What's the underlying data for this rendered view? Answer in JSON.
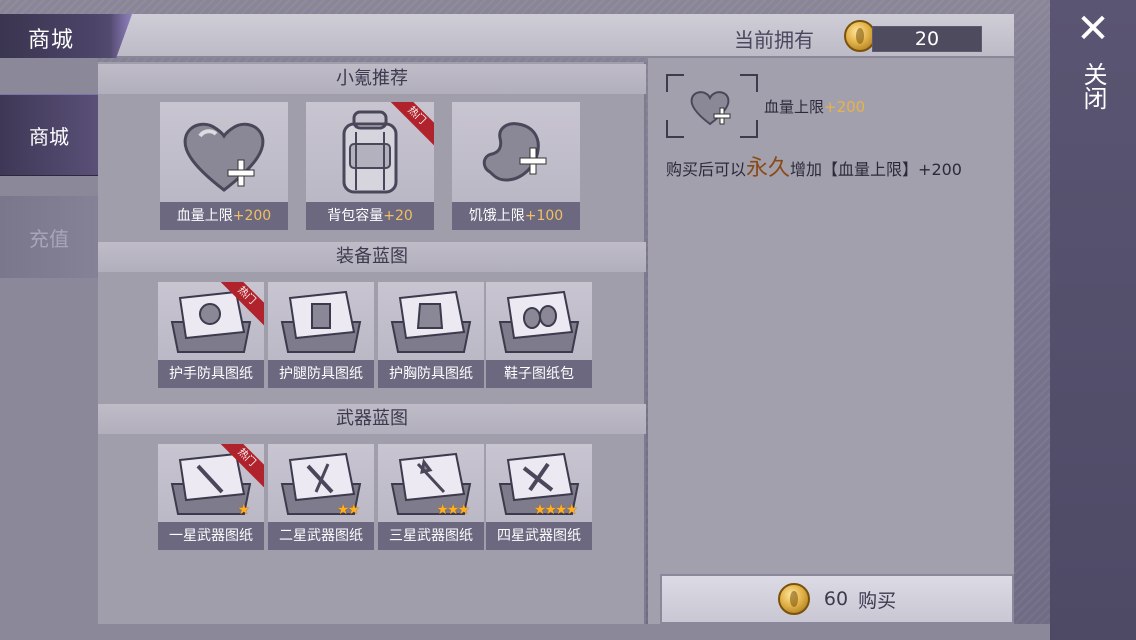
{
  "header": {
    "title": "商城",
    "owned_label": "当前拥有",
    "owned_amount": "20"
  },
  "close": {
    "icon": "close-icon",
    "label": "关闭"
  },
  "sidebar": {
    "tabs": [
      {
        "label": "商城",
        "active": true
      },
      {
        "label": "充值",
        "active": false
      }
    ]
  },
  "sections": [
    {
      "title": "小氪推荐",
      "items": [
        {
          "name": "血量上限",
          "bonus": "+200",
          "icon": "heart-plus-icon",
          "badge": "",
          "selected": true
        },
        {
          "name": "背包容量",
          "bonus": "+20",
          "icon": "backpack-icon",
          "badge": "热门",
          "selected": false
        },
        {
          "name": "饥饿上限",
          "bonus": "+100",
          "icon": "stomach-plus-icon",
          "badge": "",
          "selected": false
        }
      ]
    },
    {
      "title": "装备蓝图",
      "items": [
        {
          "name": "护手防具图纸",
          "icon": "gloves-blueprint-icon",
          "badge": "热门"
        },
        {
          "name": "护腿防具图纸",
          "icon": "pants-blueprint-icon",
          "badge": ""
        },
        {
          "name": "护胸防具图纸",
          "icon": "vest-blueprint-icon",
          "badge": ""
        },
        {
          "name": "鞋子图纸包",
          "icon": "shoes-blueprint-icon",
          "badge": ""
        }
      ]
    },
    {
      "title": "武器蓝图",
      "items": [
        {
          "name": "一星武器图纸",
          "icon": "weapon-blueprint-icon",
          "badge": "热门",
          "stars": "★"
        },
        {
          "name": "二星武器图纸",
          "icon": "weapon-blueprint-icon",
          "badge": "",
          "stars": "★★"
        },
        {
          "name": "三星武器图纸",
          "icon": "weapon-blueprint-icon",
          "badge": "",
          "stars": "★★★"
        },
        {
          "name": "四星武器图纸",
          "icon": "weapon-blueprint-icon",
          "badge": "",
          "stars": "★★★★"
        }
      ]
    }
  ],
  "detail": {
    "name": "血量上限",
    "bonus": "+200",
    "desc_prefix": "购买后可以",
    "desc_emphasis": "永久",
    "desc_suffix": "增加【血量上限】+200"
  },
  "buy": {
    "price": "60",
    "label": "购买"
  },
  "colors": {
    "accent_selected": "#ff5a1a",
    "bonus": "#f0c060",
    "ribbon": "#b0222c"
  }
}
